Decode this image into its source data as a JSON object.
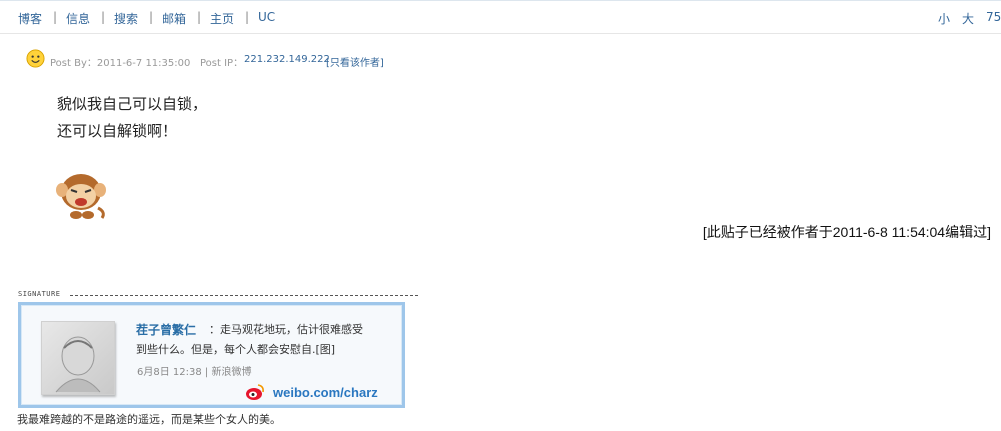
{
  "topnav": {
    "items": [
      "博客",
      "信息",
      "搜索",
      "邮箱",
      "主页",
      "UC"
    ],
    "separator": "|",
    "font_small": "小",
    "font_large": "大",
    "zoom": "75"
  },
  "post": {
    "meta_by": "Post By：2011-6-7 11:35:00",
    "meta_ip_label": "Post IP：",
    "meta_ip": "221.232.149.222",
    "only_author": "[只看该作者]",
    "content": [
      "貌似我自己可以自锁，",
      "还可以自解锁啊！"
    ],
    "edit_note": "[此贴子已经被作者于2011-6-8 11:54:04编辑过]"
  },
  "signature": {
    "label": "SIGNATURE",
    "weibo": {
      "user": "茬子曾繁仁",
      "line1": "：走马观花地玩，估计很难感受",
      "line2": "到些什么。但是，每个人都会安慰自.[图]",
      "meta": "6月8日 12:38 | 新浪微博",
      "url": "weibo.com/charz"
    },
    "motto": "我最难跨越的不是路途的遥远，而是某些个女人的美。"
  },
  "colors": {
    "link": "#336699",
    "weibo_border": "#9ec6ea",
    "weibo_url": "#2a77c0"
  }
}
